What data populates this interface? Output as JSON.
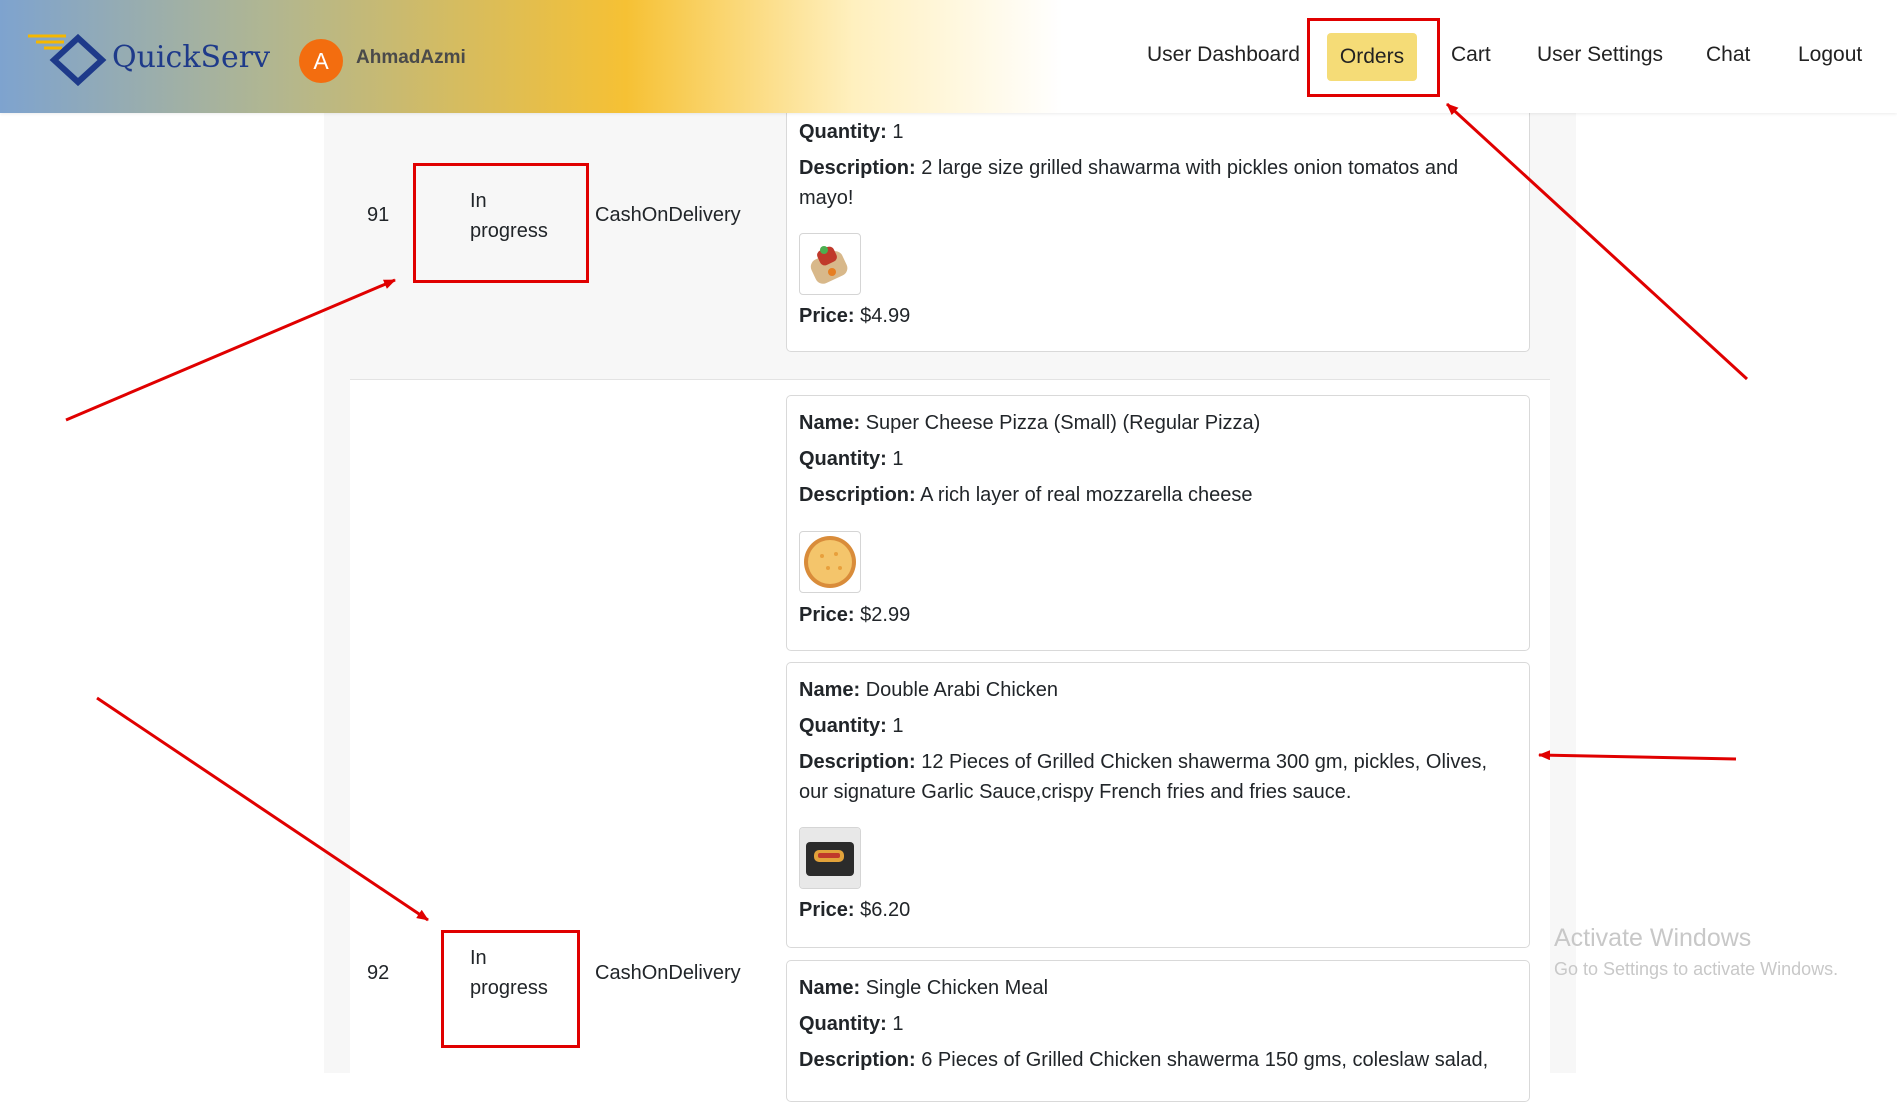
{
  "header": {
    "brand": "QuickServ",
    "avatar_initial": "A",
    "username": "AhmadAzmi",
    "nav": {
      "user_dashboard": "User Dashboard",
      "orders": "Orders",
      "cart": "Cart",
      "user_settings": "User Settings",
      "chat": "Chat",
      "logout": "Logout"
    },
    "active_color": "#f5dc77"
  },
  "labels": {
    "name": "Name:",
    "quantity": "Quantity:",
    "description": "Description:",
    "price": "Price:"
  },
  "orders": [
    {
      "id": "91",
      "status_line1": "In",
      "status_line2": "progress",
      "payment": "CashOnDelivery",
      "items": [
        {
          "quantity": "1",
          "description": "2 large size grilled shawarma with pickles onion tomatos and mayo!",
          "image_icon": "shawarma-wrap",
          "price": "$4.99"
        }
      ]
    },
    {
      "id": "92",
      "status_line1": "In",
      "status_line2": "progress",
      "payment": "CashOnDelivery",
      "items": [
        {
          "name": "Super Cheese Pizza (Small) (Regular Pizza)",
          "quantity": "1",
          "description": "A rich layer of real mozzarella cheese",
          "image_icon": "pizza",
          "price": "$2.99"
        },
        {
          "name": "Double Arabi Chicken",
          "quantity": "1",
          "description": "12 Pieces of Grilled Chicken shawerma 300 gm, pickles, Olives, our signature Garlic Sauce,crispy French fries and fries sauce.",
          "image_icon": "chicken-platter",
          "price": "$6.20"
        },
        {
          "name": "Single Chicken Meal",
          "quantity": "1",
          "description": "6 Pieces of Grilled Chicken shawerma 150 gms, coleslaw salad,"
        }
      ]
    }
  ],
  "watermark": {
    "title": "Activate Windows",
    "subtitle": "Go to Settings to activate Windows."
  },
  "annotation_color": "#e00000"
}
